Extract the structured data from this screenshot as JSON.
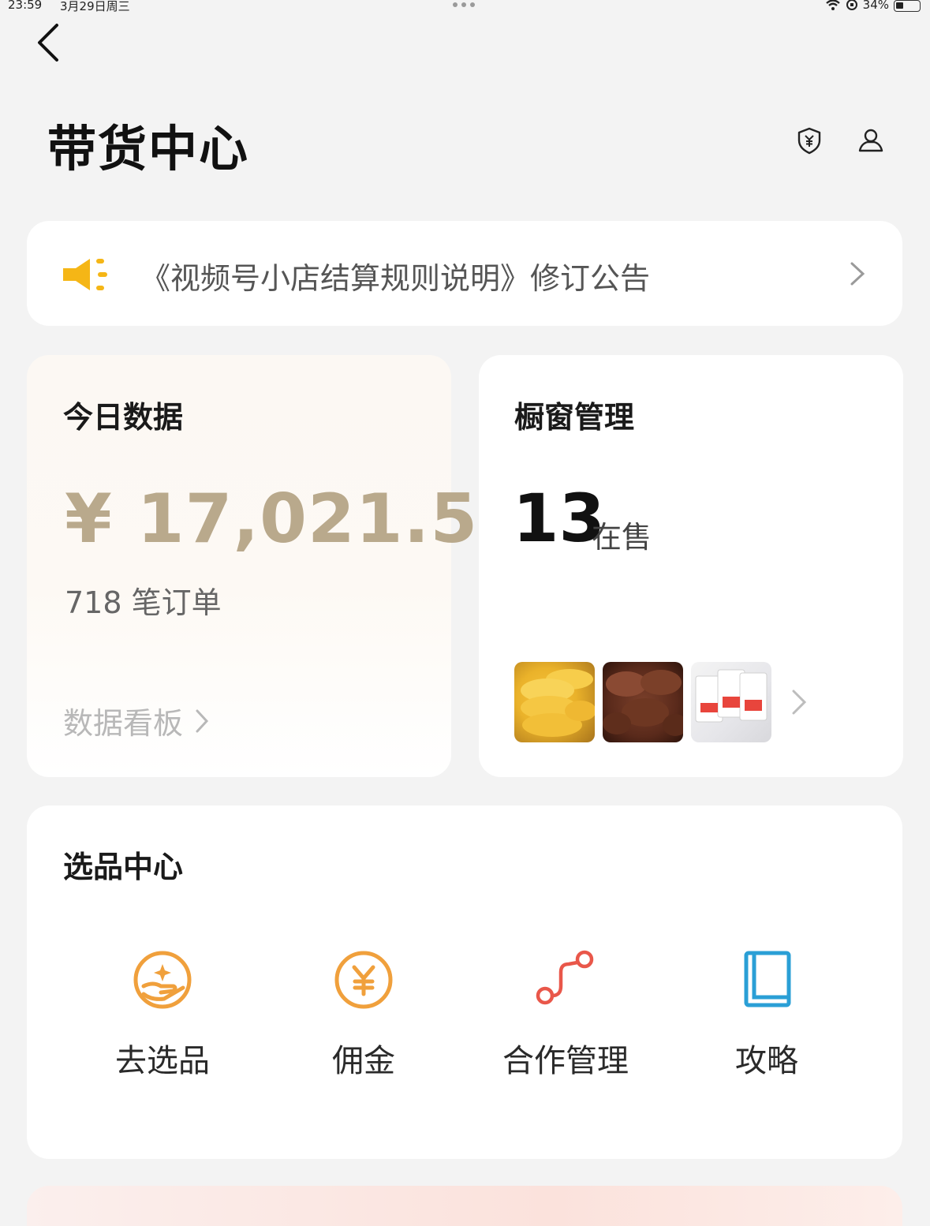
{
  "status_bar": {
    "time": "23:59",
    "date": "3月29日周三",
    "battery": "34%"
  },
  "header": {
    "title": "带货中心",
    "back_icon": "chevron-left-icon",
    "shield_icon": "shield-yen-icon",
    "user_icon": "user-icon"
  },
  "notice": {
    "icon": "megaphone-icon",
    "text": "《视频号小店结算规则说明》修订公告",
    "icon_color": "#f5b616"
  },
  "today": {
    "title": "今日数据",
    "amount": "¥ 17,021.5",
    "orders": "718 笔订单",
    "dashboard_link": "数据看板"
  },
  "window": {
    "title": "橱窗管理",
    "on_sale_count": "13",
    "on_sale_label": "在售"
  },
  "selection": {
    "title": "选品中心",
    "tools": [
      {
        "label": "去选品",
        "icon": "hand-star-icon",
        "color": "#f0a03c"
      },
      {
        "label": "佣金",
        "icon": "yen-coin-icon",
        "color": "#f0a03c"
      },
      {
        "label": "合作管理",
        "icon": "connect-path-icon",
        "color": "#e9574a"
      },
      {
        "label": "攻略",
        "icon": "book-icon",
        "color": "#2a9fd6"
      }
    ]
  },
  "colors": {
    "amount": "#b9a98c",
    "background": "#f3f3f3"
  }
}
